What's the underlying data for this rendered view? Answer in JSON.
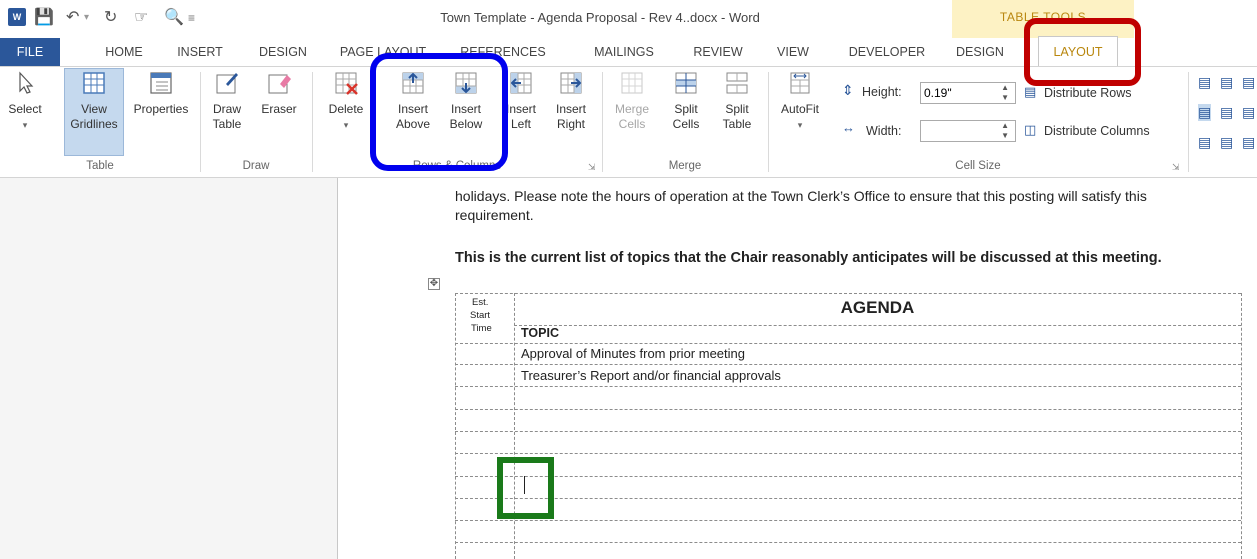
{
  "window": {
    "title": "Town Template - Agenda Proposal - Rev 4..docx - Word",
    "context_tab_group": "TABLE TOOLS"
  },
  "tabs": {
    "file": "FILE",
    "home": "HOME",
    "insert": "INSERT",
    "design": "DESIGN",
    "page_layout": "PAGE LAYOUT",
    "references": "REFERENCES",
    "mailings": "MAILINGS",
    "review": "REVIEW",
    "view": "VIEW",
    "developer": "DEVELOPER",
    "tt_design": "DESIGN",
    "tt_layout": "LAYOUT"
  },
  "ribbon": {
    "table_group": {
      "label": "Table",
      "select": "Select",
      "view_gridlines_1": "View",
      "view_gridlines_2": "Gridlines",
      "properties": "Properties"
    },
    "draw_group": {
      "label": "Draw",
      "draw_table_1": "Draw",
      "draw_table_2": "Table",
      "eraser": "Eraser"
    },
    "rows_columns_group": {
      "label": "Rows & Columns",
      "delete": "Delete",
      "insert_above_1": "Insert",
      "insert_above_2": "Above",
      "insert_below_1": "Insert",
      "insert_below_2": "Below",
      "insert_left_1": "Insert",
      "insert_left_2": "Left",
      "insert_right_1": "Insert",
      "insert_right_2": "Right"
    },
    "merge_group": {
      "label": "Merge",
      "merge_cells_1": "Merge",
      "merge_cells_2": "Cells",
      "split_cells_1": "Split",
      "split_cells_2": "Cells",
      "split_table_1": "Split",
      "split_table_2": "Table"
    },
    "cell_size_group": {
      "label": "Cell Size",
      "autofit": "AutoFit",
      "height_label": "Height:",
      "height_value": "0.19\"",
      "width_label": "Width:",
      "width_value": "",
      "distribute_rows": "Distribute Rows",
      "distribute_columns": "Distribute Columns"
    }
  },
  "document": {
    "para1_line1": "holidays.  Please note the hours of operation at the Town Clerk’s Office to ensure that this posting will satisfy this",
    "para1_line2": "requirement.",
    "para2": "This is the current list of topics that the Chair reasonably anticipates will be discussed at this meeting.",
    "table": {
      "col1_header_1": "Est.",
      "col1_header_2": "Start",
      "col1_header_3": "Time",
      "title": "AGENDA",
      "topic_header": "TOPIC",
      "rows": [
        "Approval of Minutes from prior meeting",
        "Treasurer’s Report and/or financial approvals"
      ]
    }
  },
  "highlights": {
    "layout_tab_color": "#c00000",
    "insert_buttons_color": "#0000ee",
    "cursor_cell_color": "#1a7a1a"
  }
}
